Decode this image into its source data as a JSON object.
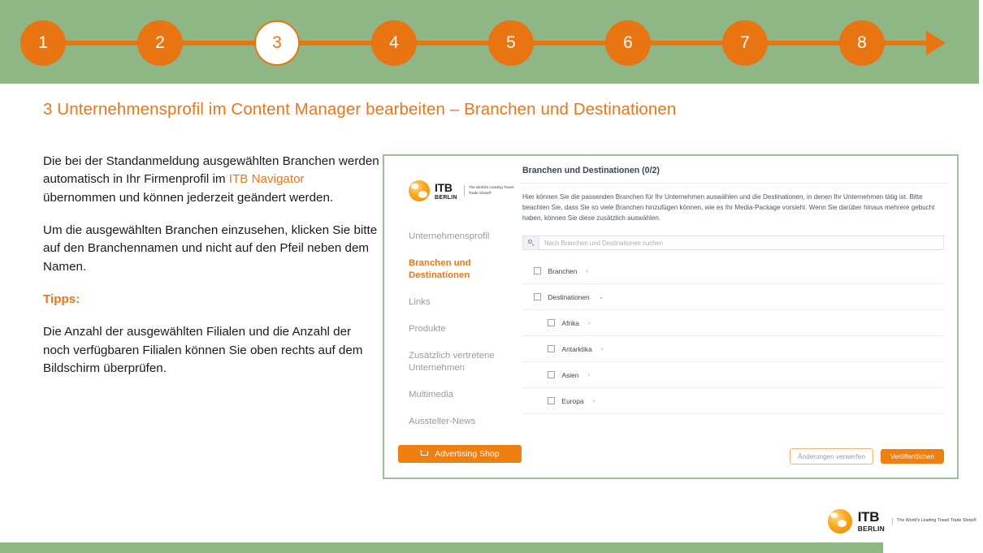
{
  "stepper": {
    "steps": [
      "1",
      "2",
      "3",
      "4",
      "5",
      "6",
      "7",
      "8"
    ],
    "current_index": 2,
    "accent_color": "#e87511",
    "band_color": "#8eb785"
  },
  "slide": {
    "title": "3 Unternehmensprofil im Content Manager bearbeiten – Branchen und Destinationen",
    "title_color": "#e8761b"
  },
  "left_text": {
    "p1_a": "Die bei der Standanmeldung ausgewählten Branchen werden automatisch in Ihr Firmenprofil im ",
    "p1_link": "ITB Navigator",
    "p1_b": " übernommen und können jederzeit geändert werden.",
    "p2": "Um die ausgewählten Branchen einzusehen, klicken Sie bitte auf den Branchennamen und nicht auf den Pfeil neben dem Namen.",
    "tips_heading": "Tipps:",
    "tips_body": "Die Anzahl der ausgewählten Filialen und die Anzahl der noch verfügbaren Filialen können Sie oben rechts auf dem Bildschirm überprüfen."
  },
  "panel": {
    "sidebar": {
      "logo": {
        "itb": "ITB",
        "berlin": "BERLIN",
        "tagline": "The World's Leading Travel Trade Show®"
      },
      "items": [
        {
          "label": "Unternehmensprofil",
          "active": false
        },
        {
          "label": "Branchen und Destinationen",
          "active": true
        },
        {
          "label": "Links",
          "active": false
        },
        {
          "label": "Produkte",
          "active": false
        },
        {
          "label": "Zusätzlich vertretene Unternehmen",
          "active": false
        },
        {
          "label": "Multimedia",
          "active": false
        },
        {
          "label": "Aussteller-News",
          "active": false
        }
      ],
      "advertising_shop_label": "Advertising Shop"
    },
    "main": {
      "title": "Branchen und Destinationen (0/2)",
      "description": "Hier können Sie die passenden Branchen für Ihr Unternehmen auswählen und die Destinationen, in denen Ihr Unternehmen tätig ist. Bitte beachten Sie, dass Sie so viele Branchen hinzufügen können, wie es Ihr Media-Package vorsieht. Wenn Sie darüber hinaus mehrere gebucht haben, können Sie diese zusätzlich auswählen.",
      "search_placeholder": "Nach Branchen und Destinationen suchen",
      "search_value": "",
      "tree": [
        {
          "label": "Branchen",
          "level": 0,
          "checked": false,
          "chevron": "›"
        },
        {
          "label": "Destinationen",
          "level": 0,
          "checked": false,
          "chevron": "⌄"
        },
        {
          "label": "Afrika",
          "level": 1,
          "checked": false,
          "chevron": "›"
        },
        {
          "label": "Antarktika",
          "level": 1,
          "checked": false,
          "chevron": "›"
        },
        {
          "label": "Asien",
          "level": 1,
          "checked": false,
          "chevron": "›"
        },
        {
          "label": "Europa",
          "level": 1,
          "checked": false,
          "chevron": "›"
        }
      ],
      "discard_label": "Änderungen verwerfen",
      "publish_label": "Veröffentlichen"
    },
    "border_color": "#9cc193"
  },
  "footer": {
    "logo": {
      "itb": "ITB",
      "berlin": "BERLIN",
      "tagline": "The World's Leading Travel Trade Show®"
    },
    "band_color": "#8eb785"
  }
}
